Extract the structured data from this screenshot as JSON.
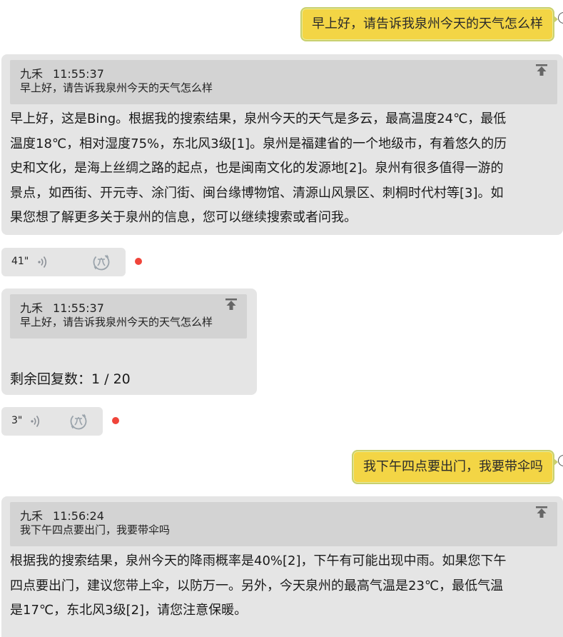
{
  "messages": {
    "user1": {
      "text": "早上好，请告诉我泉州今天的天气怎么样"
    },
    "bot1": {
      "quote_author": "九禾",
      "quote_time": "11:55:37",
      "quote_text": "早上好，请告诉我泉州今天的天气怎么样",
      "lines": [
        "早上好，这是Bing。根据我的搜索结果，泉州今天的天气是多云，最高温度24℃，最低",
        "温度18℃，相对湿度75%，东北风3级[1]。泉州是福建省的一个地级市，有着悠久的历",
        "史和文化，是海上丝绸之路的起点，也是闽南文化的发源地[2]。泉州有很多值得一游的",
        "景点，如西街、开元寺、涂门街、闽台缘博物馆、清源山风景区、刺桐时代村等[3]。如",
        "果您想了解更多关于泉州的信息，您可以继续搜索或者问我。"
      ]
    },
    "audio1": {
      "duration": "41\""
    },
    "bot2": {
      "quote_author": "九禾",
      "quote_time": "11:55:37",
      "quote_text": "早上好，请告诉我泉州今天的天气怎么样",
      "remaining": "剩余回复数：1 / 20"
    },
    "audio2": {
      "duration": "3\""
    },
    "user2": {
      "text": "我下午四点要出门，我要带伞吗"
    },
    "bot3": {
      "quote_author": "九禾",
      "quote_time": "11:56:24",
      "quote_text": "我下午四点要出门，我要带伞吗",
      "lines": [
        "根据我的搜索结果，泉州今天的降雨概率是40%[2]，下午有可能出现中雨。如果您下午",
        "四点要出门，建议您带上伞，以防万一。另外，今天泉州的最高气温是23℃，最低气温",
        "是17℃，东北风3级[2]，请您注意保暖。"
      ]
    }
  },
  "icons": {
    "pin_top": "pin-to-top-icon",
    "voice": "voice-wave-icon",
    "translate": "translate-icon"
  },
  "colors": {
    "user_bubble": "#f3d545",
    "bot_bubble": "#e5e5e5",
    "quote_bg": "#d3d3d3",
    "unread_dot": "#f0443a"
  }
}
